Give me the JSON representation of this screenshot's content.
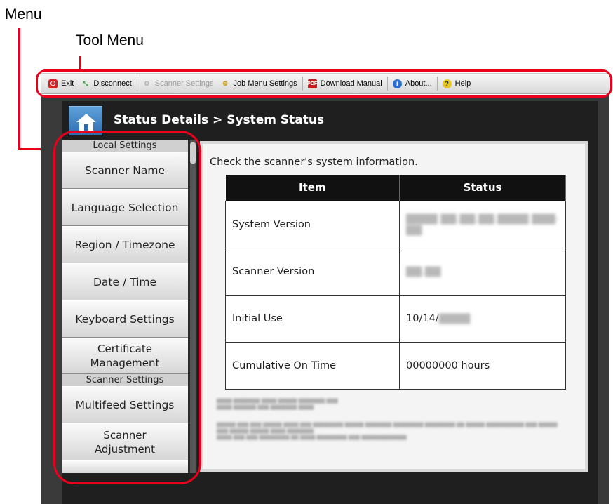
{
  "callouts": {
    "menu": "Menu",
    "tool_menu": "Tool Menu"
  },
  "toolbar": {
    "items": [
      {
        "label": "Exit",
        "icon": "exit-icon",
        "enabled": true
      },
      {
        "label": "Disconnect",
        "icon": "disconnect-icon",
        "enabled": true
      },
      {
        "label": "Scanner Settings",
        "icon": "scanner-settings-icon",
        "enabled": false
      },
      {
        "label": "Job Menu Settings",
        "icon": "job-menu-icon",
        "enabled": true
      },
      {
        "label": "Download Manual",
        "icon": "pdf-icon",
        "enabled": true
      },
      {
        "label": "About...",
        "icon": "info-icon",
        "enabled": true
      },
      {
        "label": "Help",
        "icon": "help-icon",
        "enabled": true
      }
    ]
  },
  "header": {
    "title": "Status Details > System Status"
  },
  "sidemenu": {
    "local_header": "Local Settings",
    "local_items": [
      "Scanner Name",
      "Language Selection",
      "Region / Timezone",
      "Date / Time",
      "Keyboard Settings",
      "Certificate Management"
    ],
    "scanner_header": "Scanner Settings",
    "scanner_items": [
      "Multifeed Settings",
      "Scanner Adjustment"
    ]
  },
  "content": {
    "description": "Check the scanner's system information.",
    "table": {
      "headers": [
        "Item",
        "Status"
      ],
      "rows": [
        {
          "item": "System Version",
          "status": "[blurred]"
        },
        {
          "item": "Scanner Version",
          "status": "[blurred]"
        },
        {
          "item": "Initial Use",
          "status": "10/14/"
        },
        {
          "item": "Cumulative On Time",
          "status": "00000000 hours"
        }
      ]
    }
  },
  "colors": {
    "highlight": "#e8001c",
    "header_bg": "#111111",
    "home_blue": "#2f6db0"
  }
}
